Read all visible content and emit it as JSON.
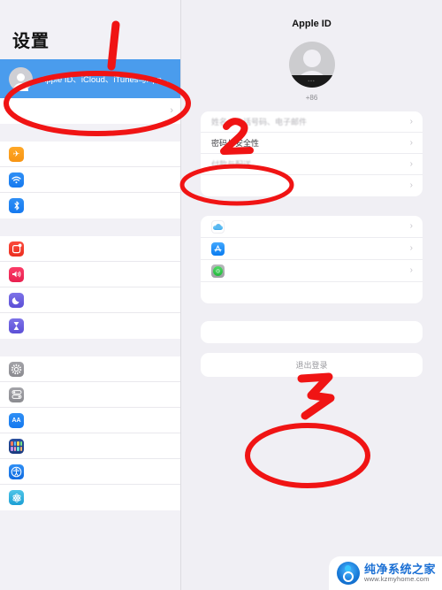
{
  "sidebar": {
    "title": "设置",
    "account_row": {
      "label": "Apple ID、iCloud、iTunes与App...",
      "icon": "avatar-placeholder-icon",
      "selected": true,
      "highlight_color": "#4a9ced"
    },
    "second_row": {
      "label": "",
      "chevron": "›"
    },
    "groups": [
      {
        "items": [
          {
            "label": "",
            "icon": "airplane-mode-icon",
            "icon_class": "i-air",
            "glyph": "✈"
          },
          {
            "label": "",
            "icon": "wifi-icon",
            "icon_class": "i-wifi",
            "glyph": "≋"
          },
          {
            "label": "",
            "icon": "bluetooth-icon",
            "icon_class": "i-bt",
            "glyph": "✖"
          }
        ]
      },
      {
        "items": [
          {
            "label": "",
            "icon": "notifications-icon",
            "icon_class": "i-notif",
            "glyph": "▣"
          },
          {
            "label": "",
            "icon": "sounds-icon",
            "icon_class": "i-sound",
            "glyph": "◀"
          },
          {
            "label": "",
            "icon": "do-not-disturb-icon",
            "icon_class": "i-dnd",
            "glyph": "☾"
          },
          {
            "label": "",
            "icon": "screen-time-icon",
            "icon_class": "i-screen",
            "glyph": "⧗"
          }
        ]
      },
      {
        "items": [
          {
            "label": "",
            "icon": "general-gear-icon",
            "icon_class": "i-gen",
            "glyph": "⚙"
          },
          {
            "label": "",
            "icon": "control-center-icon",
            "icon_class": "i-ctrl",
            "glyph": "⊜"
          },
          {
            "label": "",
            "icon": "display-brightness-icon",
            "icon_class": "i-disp",
            "glyph": "AA"
          },
          {
            "label": "",
            "icon": "home-screen-dock-icon",
            "icon_class": "i-home",
            "glyph": ""
          },
          {
            "label": "",
            "icon": "accessibility-icon",
            "icon_class": "i-acc",
            "glyph": "♿"
          },
          {
            "label": "",
            "icon": "wallpaper-icon",
            "icon_class": "i-wall",
            "glyph": "✺"
          }
        ]
      }
    ]
  },
  "panel": {
    "title": "Apple ID",
    "avatar": {
      "icon": "person-avatar-icon",
      "redacted_name": "▪▪▪"
    },
    "account_subtitle": "+86",
    "account_card": [
      {
        "label": "姓名、电话号码、电子邮件",
        "chevron": "›",
        "state": "blurred"
      },
      {
        "label": "密码与安全性",
        "chevron": "›",
        "state": "normal"
      },
      {
        "label": "付款与配送",
        "chevron": "›",
        "state": "blurred"
      },
      {
        "label": "",
        "chevron": "›",
        "state": "blank"
      }
    ],
    "services_card": [
      {
        "label": "",
        "icon": "icloud-icon",
        "chevron": "›"
      },
      {
        "label": "",
        "icon": "app-store-icon",
        "chevron": "›"
      },
      {
        "label": "",
        "icon": "find-my-icon",
        "chevron": "›"
      },
      {
        "label": "",
        "icon": "",
        "chevron": ""
      }
    ],
    "devices_card_blank": "",
    "sign_out_label": "退出登录"
  },
  "annotations": {
    "color": "#f01414",
    "marks": [
      {
        "name": "step-1-stroke",
        "text": "1"
      },
      {
        "name": "step-1-ellipse",
        "text": ""
      },
      {
        "name": "step-2-stroke",
        "text": "2"
      },
      {
        "name": "step-2-ellipse",
        "text": ""
      },
      {
        "name": "step-3-stroke",
        "text": "3"
      },
      {
        "name": "step-3-ellipse",
        "text": ""
      }
    ]
  },
  "watermark": {
    "brand_cn": "纯净系统之家",
    "url": "www.kzmyhome.com",
    "logo_icon": "brand-circle-logo-icon"
  }
}
